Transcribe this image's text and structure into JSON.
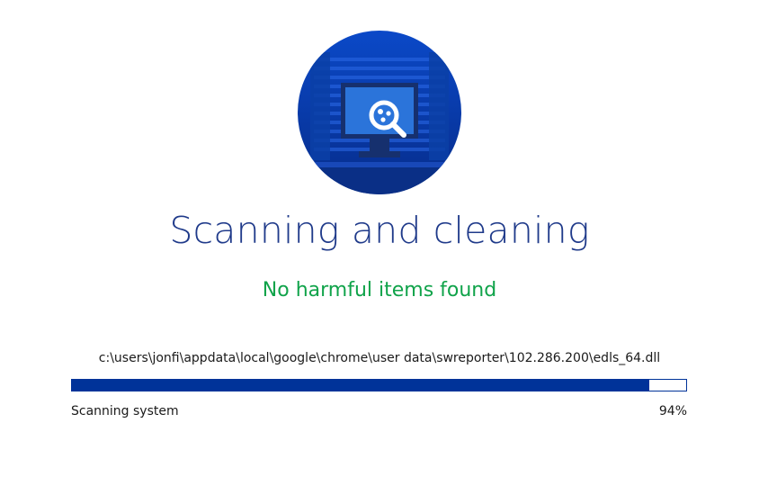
{
  "hero": {
    "icon": "monitor-magnifier-scan-icon",
    "colors": {
      "circle": "#0a3fb0",
      "accent": "#1a5fe0",
      "screen": "#1f6bd6"
    }
  },
  "scan": {
    "title": "Scanning and cleaning",
    "status": "No harmful items found",
    "current_file": "c:\\users\\jonfi\\appdata\\local\\google\\chrome\\user data\\swreporter\\102.286.200\\edls_64.dll",
    "progress_label": "Scanning system",
    "progress_percent_text": "94%",
    "progress_value": 0.94
  },
  "colors": {
    "title": "#1f3a8a",
    "status": "#10a34a",
    "progress": "#003399"
  }
}
